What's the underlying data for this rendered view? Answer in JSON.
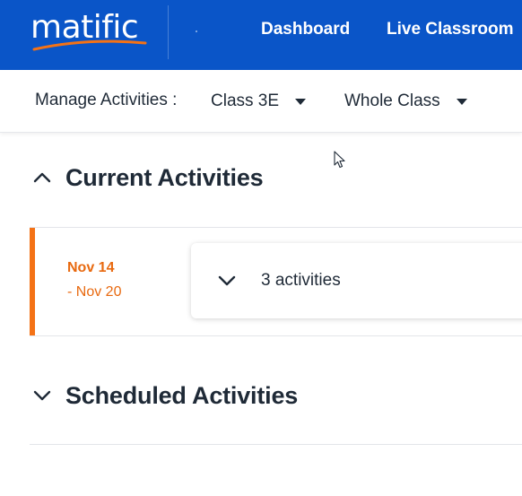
{
  "header": {
    "logo_text": "matific",
    "nav": [
      {
        "label": "Dashboard"
      },
      {
        "label": "Live Classroom"
      }
    ]
  },
  "manage_bar": {
    "label": "Manage Activities :",
    "class_selector": {
      "value": "Class 3E"
    },
    "group_selector": {
      "value": "Whole Class"
    }
  },
  "sections": {
    "current": {
      "title": "Current Activities",
      "expanded": true,
      "weeks": [
        {
          "start": "Nov 14",
          "end": "- Nov 20",
          "summary": "3 activities",
          "accent_color": "#f47216"
        }
      ]
    },
    "scheduled": {
      "title": "Scheduled Activities",
      "expanded": false
    }
  },
  "colors": {
    "nav_bg": "#0a55c8",
    "accent_orange": "#f47216",
    "text_dark": "#1f2a37"
  }
}
